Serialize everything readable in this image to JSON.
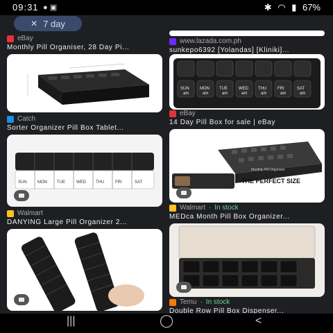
{
  "status_bar": {
    "time": "09:31",
    "battery": "67%"
  },
  "filter_chip": {
    "label": "7 day"
  },
  "results": [
    {
      "source": "eBay",
      "title": "Monthly Pill Organiser, 28 Day Pi...",
      "fav_color": "#e53238"
    },
    {
      "source": "www.lazada.com.ph",
      "title": "sunkepo6392 [Yolandas] [Kliniki]...",
      "fav_color": "#6a2cff"
    },
    {
      "source": "Catch",
      "title": "Sorter Organizer Pill Box Tablet...",
      "fav_color": "#1a8fe3"
    },
    {
      "source": "eBay",
      "title": "14 Day Pill Box for sale | eBay",
      "fav_color": "#e53238"
    },
    {
      "source": "Walmart",
      "title": "DANYING Large Pill Organizer 2...",
      "fav_color": "#ffc220"
    },
    {
      "source": "Walmart",
      "stock": "In stock",
      "title": "MEDca Month Pill Box Organizer...",
      "fav_color": "#ffc220"
    },
    {
      "source": "Temu",
      "stock": "In stock",
      "title": "Double Row Pill Box Dispenser...",
      "fav_color": "#f57c00"
    }
  ],
  "image_labels": {
    "days_upper": [
      "SUN",
      "MON",
      "TUE",
      "WED",
      "THU",
      "FRI",
      "SAT"
    ],
    "am": "am",
    "perfect_size": "THE PERFECT SIZE",
    "medca_caption": "Monthly Pill Organizer"
  }
}
